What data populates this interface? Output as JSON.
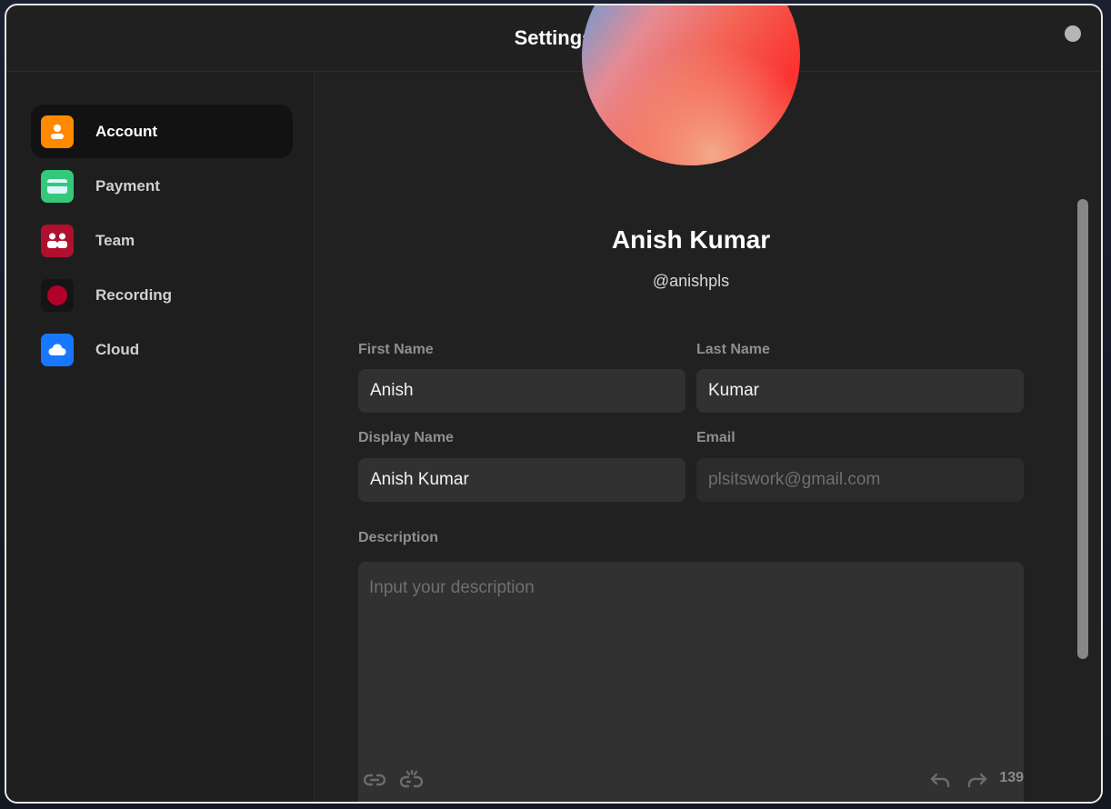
{
  "window": {
    "title": "Settings"
  },
  "sidebar": {
    "items": [
      {
        "label": "Account",
        "icon": "user-icon",
        "color": "#ff8a00",
        "active": true
      },
      {
        "label": "Payment",
        "icon": "credit-card-icon",
        "color": "#34c97a",
        "active": false
      },
      {
        "label": "Team",
        "icon": "team-icon",
        "color": "#b0102e",
        "active": false
      },
      {
        "label": "Recording",
        "icon": "record-icon",
        "color": "#c4002f",
        "active": false
      },
      {
        "label": "Cloud",
        "icon": "cloud-icon",
        "color": "#1877ff",
        "active": false
      }
    ]
  },
  "profile": {
    "name": "Anish Kumar",
    "handle": "@anishpls"
  },
  "form": {
    "first_name": {
      "label": "First Name",
      "value": "Anish"
    },
    "last_name": {
      "label": "Last Name",
      "value": "Kumar"
    },
    "display_name": {
      "label": "Display Name",
      "value": "Anish Kumar"
    },
    "email": {
      "label": "Email",
      "placeholder": "plsitswork@gmail.com"
    },
    "description": {
      "label": "Description",
      "placeholder": "Input your description",
      "char_count": "139"
    }
  },
  "colors": {
    "window_bg": "#202020",
    "sidebar_active_bg": "#121212",
    "input_bg": "#313131"
  }
}
